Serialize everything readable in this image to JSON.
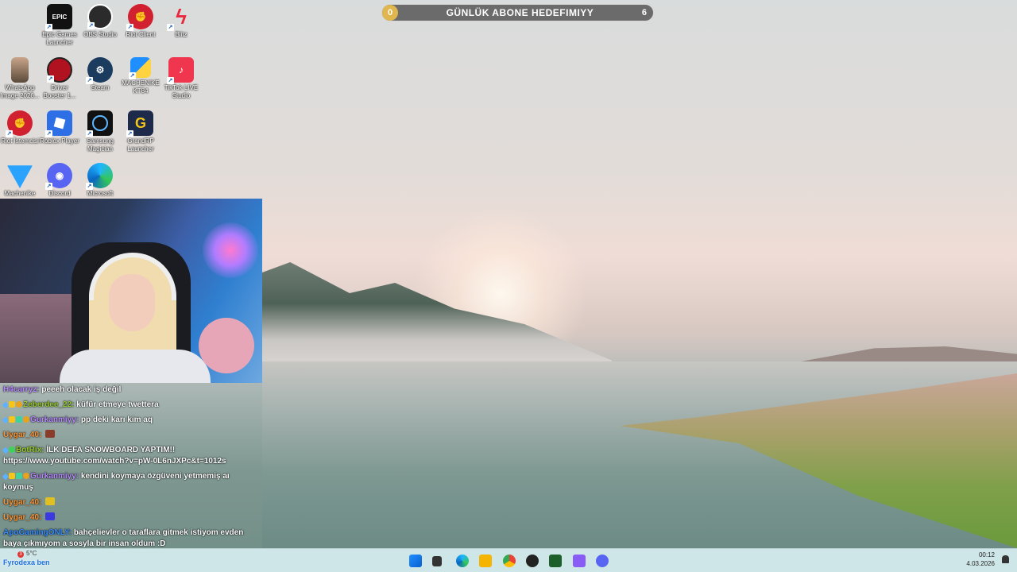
{
  "goal": {
    "start_value": "0",
    "title": "GÜNLÜK ABONE HEDEFIMIYY",
    "end_value": "6"
  },
  "desktop_icons": [
    {
      "name": "epic-games-icon",
      "label": "Epic Games\nLauncher",
      "tile_text": "EPIC"
    },
    {
      "name": "obs-studio-icon",
      "label": "OBS Studio",
      "tile_text": ""
    },
    {
      "name": "riot-client-icon",
      "label": "Riot Client",
      "tile_text": ""
    },
    {
      "name": "blitz-icon",
      "label": "Blitz",
      "tile_text": ""
    },
    {
      "name": "whatsapp-image-icon",
      "label": "WhatsApp\nImage 2026...",
      "tile_text": ""
    },
    {
      "name": "driver-booster-icon",
      "label": "Driver\nBooster 1...",
      "tile_text": ""
    },
    {
      "name": "steam-icon",
      "label": "Steam",
      "tile_text": ""
    },
    {
      "name": "machenike-kt84-icon",
      "label": "MACHENIKE\nKT84",
      "tile_text": ""
    },
    {
      "name": "tiktok-live-studio-icon",
      "label": "TikTok LIVE\nStudio",
      "tile_text": ""
    },
    {
      "name": "riot-istemcisi-icon",
      "label": "Riot İstemcisi",
      "tile_text": ""
    },
    {
      "name": "roblox-player-icon",
      "label": "Roblox Player",
      "tile_text": ""
    },
    {
      "name": "samsung-magician-icon",
      "label": "Samsung\nMagician",
      "tile_text": ""
    },
    {
      "name": "grandrp-launcher-icon",
      "label": "GrandRP\nLauncher",
      "tile_text": "G"
    },
    {
      "name": "machenike-icon",
      "label": "Machenike",
      "tile_text": ""
    },
    {
      "name": "discord-icon",
      "label": "Discord",
      "tile_text": ""
    },
    {
      "name": "microsoft-edge-icon",
      "label": "Microsoft",
      "tile_text": ""
    }
  ],
  "chat": [
    {
      "user": "H4carryz",
      "user_color": "#b88cff",
      "badges": [],
      "text": "peeeh olacak iş değil"
    },
    {
      "user": "Zeberdee_22",
      "user_color": "#9acd32",
      "badges": [
        "sword",
        "crown",
        "coin"
      ],
      "text": "küfür etmeye twettera"
    },
    {
      "user": "Gurkanmiyy",
      "user_color": "#b88cff",
      "badges": [
        "sword",
        "crown",
        "gift",
        "coin"
      ],
      "text": "pp deki karı kim aq"
    },
    {
      "user": "Uygar_40",
      "user_color": "#ff9a3c",
      "badges": [],
      "text": "",
      "emote": "#8a3b2a"
    },
    {
      "user": "BotRix",
      "user_color": "#9acd32",
      "badges": [
        "sword",
        "gear"
      ],
      "text": "İLK DEFA SNOWBOARD YAPTIM!! https://www.youtube.com/watch?v=pW-0L6nJXPc&t=1012s"
    },
    {
      "user": "Gurkanmiyy",
      "user_color": "#b88cff",
      "badges": [
        "sword",
        "crown",
        "gift",
        "coin"
      ],
      "text": "kendini koymaya özgüveni yetmemiş aı koymuş"
    },
    {
      "user": "Uygar_40",
      "user_color": "#ff9a3c",
      "badges": [],
      "text": "",
      "emote": "#e0c020"
    },
    {
      "user": "Uygar_40",
      "user_color": "#ff9a3c",
      "badges": [],
      "text": "",
      "emote": "#3a3ae0"
    },
    {
      "user": "ApoGamingONLY",
      "user_color": "#3a8fff",
      "badges": [],
      "text": "bahçelievler o taraflara gitmek istiyom evden baya çıkmıyom a sosyla bir insan oldum :D"
    }
  ],
  "overlay_bottom": "Fyrodexa ben",
  "weather": {
    "badge": "3",
    "temp": "5°C"
  },
  "clock": {
    "time": "00:12",
    "date": "4.03.2026"
  },
  "colors": {
    "goal_start": "#e0b74e",
    "taskbar": "#cfe6e8"
  }
}
